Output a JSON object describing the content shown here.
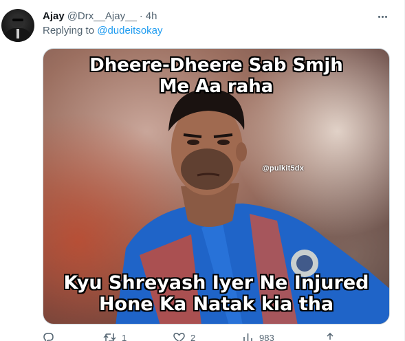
{
  "tweet": {
    "author_name": "Ajay",
    "author_handle": "@Drx__Ajay__",
    "separator": "·",
    "time": "4h",
    "replying_prefix": "Replying to",
    "replying_to": "@dudeitsokay"
  },
  "media": {
    "caption_top_line1": "Dheere-Dheere Sab Smjh",
    "caption_top_line2": "Me Aa raha",
    "caption_bottom_line1": "Kyu Shreyash Iyer Ne Injured",
    "caption_bottom_line2": "Hone Ka Natak kia tha",
    "watermark": "@pulkit5dx"
  },
  "actions": {
    "reply_count": "",
    "retweet_count": "1",
    "like_count": "2",
    "view_count": "983"
  },
  "icons": [
    "more-icon",
    "reply-icon",
    "retweet-icon",
    "like-icon",
    "views-icon",
    "share-icon"
  ],
  "colors": {
    "accent": "#1d9bf0",
    "muted": "#536471",
    "text": "#0f1419"
  }
}
